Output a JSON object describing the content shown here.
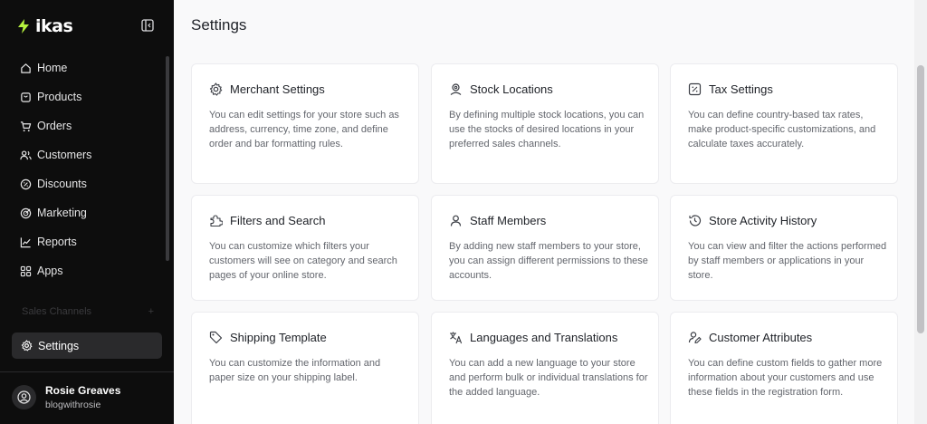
{
  "app": {
    "logo_text": "ikas"
  },
  "sidebar": {
    "items": [
      {
        "label": "Home",
        "icon": "home-icon"
      },
      {
        "label": "Products",
        "icon": "bag-icon"
      },
      {
        "label": "Orders",
        "icon": "cart-icon"
      },
      {
        "label": "Customers",
        "icon": "users-icon"
      },
      {
        "label": "Discounts",
        "icon": "discount-icon"
      },
      {
        "label": "Marketing",
        "icon": "marketing-icon"
      },
      {
        "label": "Reports",
        "icon": "chart-icon"
      },
      {
        "label": "Apps",
        "icon": "apps-icon"
      }
    ],
    "sales_channels_label": "Sales Channels",
    "sales_channels_add": "+",
    "settings_label": "Settings"
  },
  "user": {
    "name": "Rosie Greaves",
    "handle": "blogwithrosie"
  },
  "main": {
    "title": "Settings",
    "cards": [
      {
        "title": "Merchant Settings",
        "icon": "gear-icon",
        "desc": "You can edit settings for your store such as address, currency, time zone, and define order and bar formatting rules."
      },
      {
        "title": "Stock Locations",
        "icon": "location-icon",
        "desc": "By defining multiple stock locations, you can use the stocks of desired locations in your preferred sales channels."
      },
      {
        "title": "Tax Settings",
        "icon": "tax-icon",
        "desc": "You can define country-based tax rates, make product-specific customizations, and calculate taxes accurately."
      },
      {
        "title": "Filters and Search",
        "icon": "puzzle-icon",
        "desc": "You can customize which filters your customers will see on category and search pages of your online store."
      },
      {
        "title": "Staff Members",
        "icon": "user-icon",
        "desc": "By adding new staff members to your store, you can assign different permissions to these accounts."
      },
      {
        "title": "Store Activity History",
        "icon": "history-icon",
        "desc": "You can view and filter the actions performed by staff members or applications in your store."
      },
      {
        "title": "Shipping Template",
        "icon": "tag-icon",
        "desc": "You can customize the information and paper size on your shipping label."
      },
      {
        "title": "Languages and Translations",
        "icon": "translate-icon",
        "desc": "You can add a new language to your store and perform bulk or individual translations for the added language."
      },
      {
        "title": "Customer Attributes",
        "icon": "user-edit-icon",
        "desc": "You can define custom fields to gather more information about your customers and use these fields in the registration form."
      }
    ]
  },
  "colors": {
    "sidebar_bg": "#0d0d0d",
    "logo_accent": "#b6f23e",
    "card_bg": "#ffffff",
    "page_bg": "#f9f9fa"
  }
}
